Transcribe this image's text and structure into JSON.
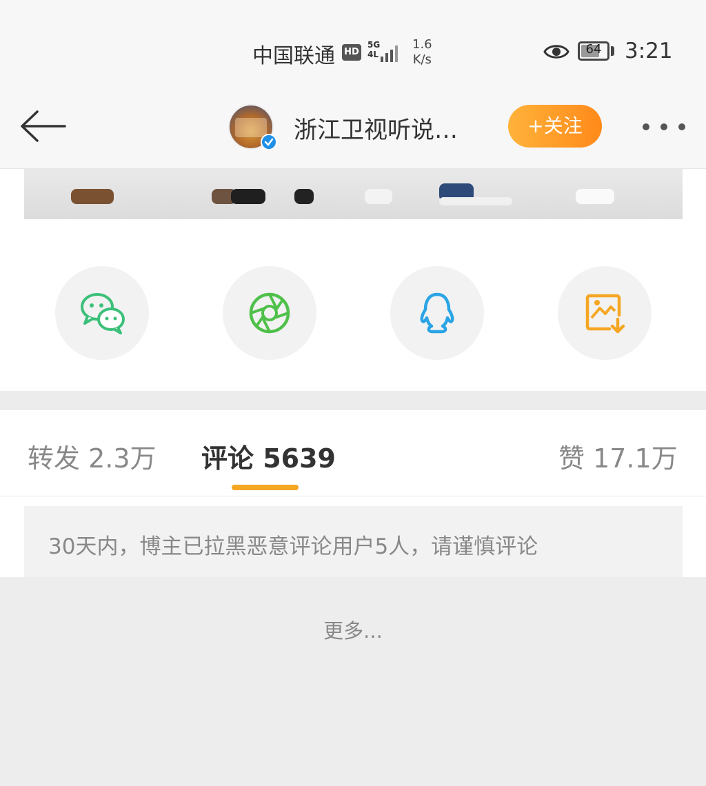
{
  "status_bar": {
    "carrier": "中国联通",
    "hd": "HD",
    "network": "5G",
    "lte": "4L",
    "speed_value": "1.6",
    "speed_unit": "K/s",
    "battery": "64",
    "time": "3:21"
  },
  "header": {
    "account_name": "浙江卫视听说…",
    "follow_label": "+关注"
  },
  "share": {
    "items": [
      {
        "icon": "wechat-icon",
        "color": "#3cc07a"
      },
      {
        "icon": "moments-icon",
        "color": "#4fc04a"
      },
      {
        "icon": "qq-icon",
        "color": "#2aa4e6"
      },
      {
        "icon": "save-image-icon",
        "color": "#f5a623"
      }
    ]
  },
  "tabs": {
    "repost": "转发 2.3万",
    "comment": "评论 5639",
    "like": "赞 17.1万",
    "active": "comment",
    "accent_color": "#f5a623"
  },
  "notice": {
    "text": "30天内，博主已拉黑恶意评论用户5人，请谨慎评论"
  },
  "more": {
    "label": "更多..."
  }
}
